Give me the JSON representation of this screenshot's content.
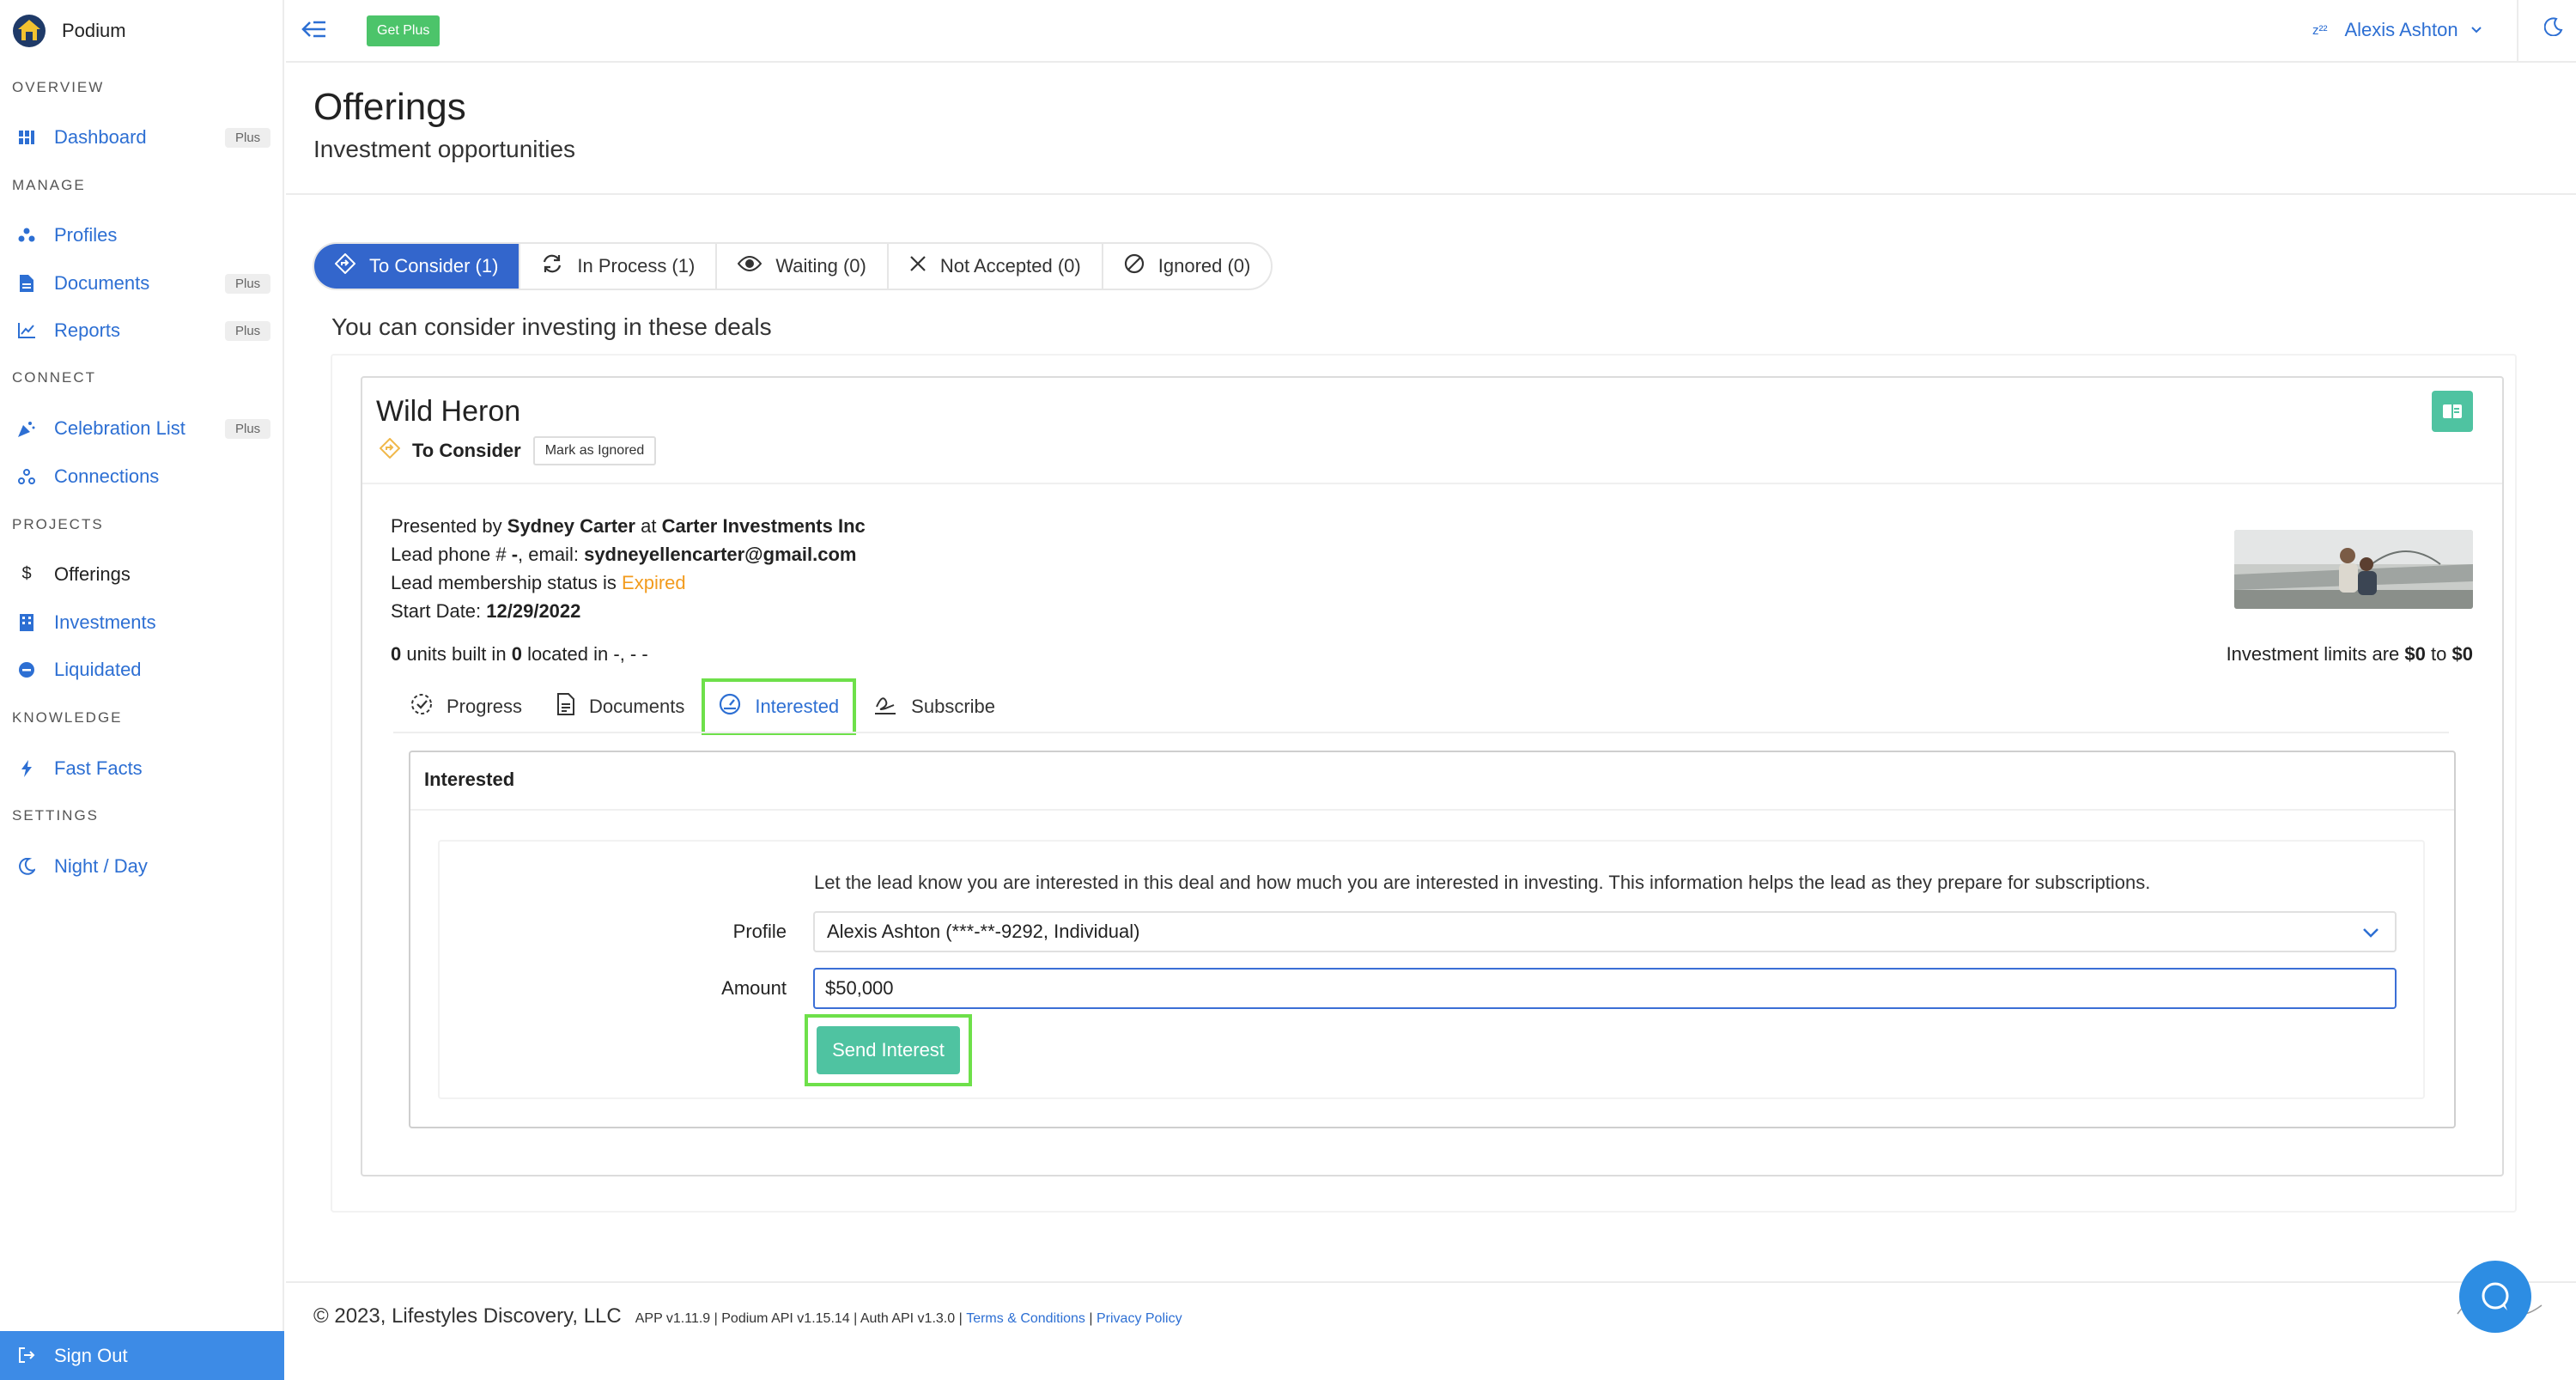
{
  "app": {
    "name": "Podium"
  },
  "sidebar": {
    "sections": [
      {
        "title": "OVERVIEW"
      },
      {
        "title": "MANAGE"
      },
      {
        "title": "CONNECT"
      },
      {
        "title": "PROJECTS"
      },
      {
        "title": "KNOWLEDGE"
      },
      {
        "title": "SETTINGS"
      }
    ],
    "items": [
      {
        "label": "Dashboard",
        "icon": "dashboard-icon",
        "badge": "Plus"
      },
      {
        "label": "Profiles",
        "icon": "users-icon"
      },
      {
        "label": "Documents",
        "icon": "file-icon",
        "badge": "Plus"
      },
      {
        "label": "Reports",
        "icon": "chart-icon",
        "badge": "Plus"
      },
      {
        "label": "Celebration List",
        "icon": "party-icon",
        "badge": "Plus"
      },
      {
        "label": "Connections",
        "icon": "network-icon"
      },
      {
        "label": "Offerings",
        "icon": "dollar-icon"
      },
      {
        "label": "Investments",
        "icon": "building-icon"
      },
      {
        "label": "Liquidated",
        "icon": "minus-circle-icon"
      },
      {
        "label": "Fast Facts",
        "icon": "bolt-icon"
      },
      {
        "label": "Night / Day",
        "icon": "moon-icon"
      }
    ],
    "signout": "Sign Out"
  },
  "topbar": {
    "get_plus": "Get Plus",
    "user_name": "Alexis Ashton",
    "user_prefix": "z²²"
  },
  "header": {
    "title": "Offerings",
    "subtitle": "Investment opportunities"
  },
  "tabs": [
    {
      "label": "To Consider (1)"
    },
    {
      "label": "In Process (1)"
    },
    {
      "label": "Waiting (0)"
    },
    {
      "label": "Not Accepted (0)"
    },
    {
      "label": "Ignored (0)"
    }
  ],
  "deals_caption": "You can consider investing in these deals",
  "deal": {
    "title": "Wild Heron",
    "status": "To Consider",
    "mark_ignored": "Mark as Ignored",
    "presented_prefix": "Presented by",
    "presenter": "Sydney Carter",
    "at": "at",
    "company": "Carter Investments Inc",
    "lead_phone_prefix": "Lead phone #",
    "lead_phone": "-",
    "email_prefix": ", email:",
    "email": "sydneyellencarter@gmail.com",
    "membership_prefix": "Lead membership status is",
    "membership_status": "Expired",
    "start_prefix": "Start Date:",
    "start_date": "12/29/2022",
    "units": "0",
    "units_mid": "units built in",
    "located_count": "0",
    "located_mid": "located in",
    "location": "-, - -",
    "limits_prefix": "Investment limits are",
    "limit_min": "$0",
    "limit_to": "to",
    "limit_max": "$0",
    "accent_color": "#f29b1d"
  },
  "subtabs": [
    {
      "label": "Progress"
    },
    {
      "label": "Documents"
    },
    {
      "label": "Interested"
    },
    {
      "label": "Subscribe"
    }
  ],
  "interested": {
    "heading": "Interested",
    "help": "Let the lead know you are interested in this deal and how much you are interested in investing. This information helps the lead as they prepare for subscriptions.",
    "profile_label": "Profile",
    "profile_value": "Alexis Ashton (***-**-9292, Individual)",
    "amount_label": "Amount",
    "amount_value": "$50,000",
    "send_label": "Send Interest"
  },
  "footer": {
    "copyright": "© 2023, Lifestyles Discovery, LLC",
    "versions": "APP v1.11.9 | Podium API v1.15.14 | Auth API v1.3.0 |",
    "terms": "Terms & Conditions",
    "sep": "|",
    "privacy": "Privacy Policy"
  }
}
